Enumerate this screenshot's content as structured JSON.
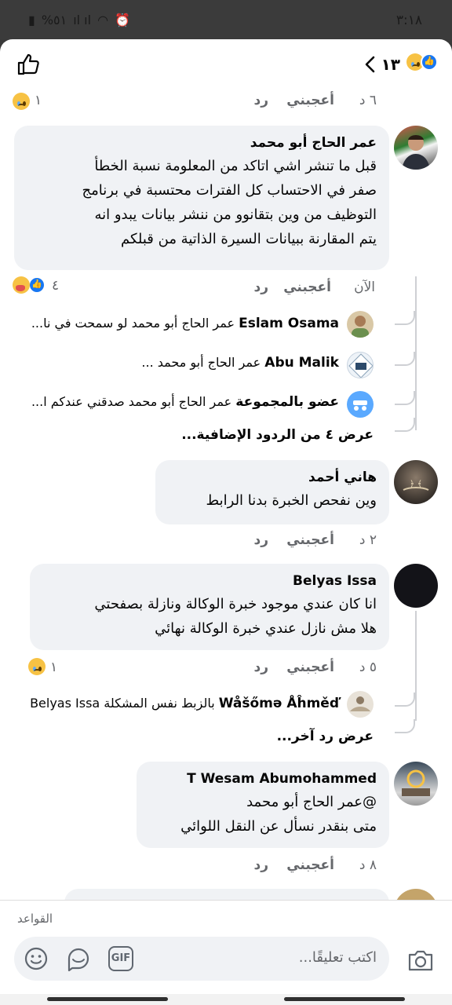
{
  "status": {
    "time": "٣:١٨",
    "battery": "%٥١"
  },
  "header": {
    "reaction_count": "١٣"
  },
  "top_meta": {
    "time": "٦ د",
    "like": "أعجبني",
    "reply": "رد",
    "reaction_count": "١"
  },
  "comments": [
    {
      "name": "عمر الحاج أبو محمد",
      "lines": [
        "قبل ما تنشر اشي اتاكد من المعلومة نسبة الخطأ",
        "صفر في الاحتساب كل الفترات محتسبة في برنامج",
        "التوظيف من وين بتقانوو من ننشر بيانات يبدو انه",
        "يتم المقارنة ببيانات السيرة الذاتية من قبلكم"
      ],
      "time": "الآن",
      "like": "أعجبني",
      "reply": "رد",
      "reaction_count": "٤"
    },
    {
      "name": "هاني أحمد",
      "lines": [
        "وين نفحص الخبرة بدنا الرابط"
      ],
      "time": "٢ د",
      "like": "أعجبني",
      "reply": "رد"
    },
    {
      "name": "Belyas Issa",
      "lines": [
        "انا كان عندي موجود خبرة الوكالة ونازلة بصفحتي",
        "هلا مش نازل عندي خبرة الوكالة نهائي"
      ],
      "time": "٥ د",
      "like": "أعجبني",
      "reply": "رد",
      "reaction_count": "١"
    },
    {
      "name": "T Wesam Abumohammed",
      "lines": [
        "@عمر الحاج أبو محمد",
        "متى بنقدر نسأل عن النقل اللوائي"
      ],
      "time": "٨ د",
      "like": "أعجبني",
      "reply": "رد"
    }
  ],
  "replies_1": [
    {
      "name": "Eslam Osama",
      "preview": "عمر الحاج أبو محمد لو سمحت في نا..."
    },
    {
      "name": "Abu Malik",
      "preview": "عمر الحاج أبو محمد ..."
    },
    {
      "name": "عضو بالمجموعة",
      "preview": "عمر الحاج أبو محمد صدقني عندكم ا..."
    }
  ],
  "more_replies_1": "عرض ٤ من الردود الإضافية...",
  "replies_3": [
    {
      "name": "Wåšőmə Åĥměď",
      "preview": "بالزبط نفس المشكلة Belyas Issa"
    }
  ],
  "more_replies_3": "عرض رد آخر...",
  "footer": {
    "rules": "القواعد",
    "placeholder": "اكتب تعليقًا...",
    "gif": "GIF"
  }
}
